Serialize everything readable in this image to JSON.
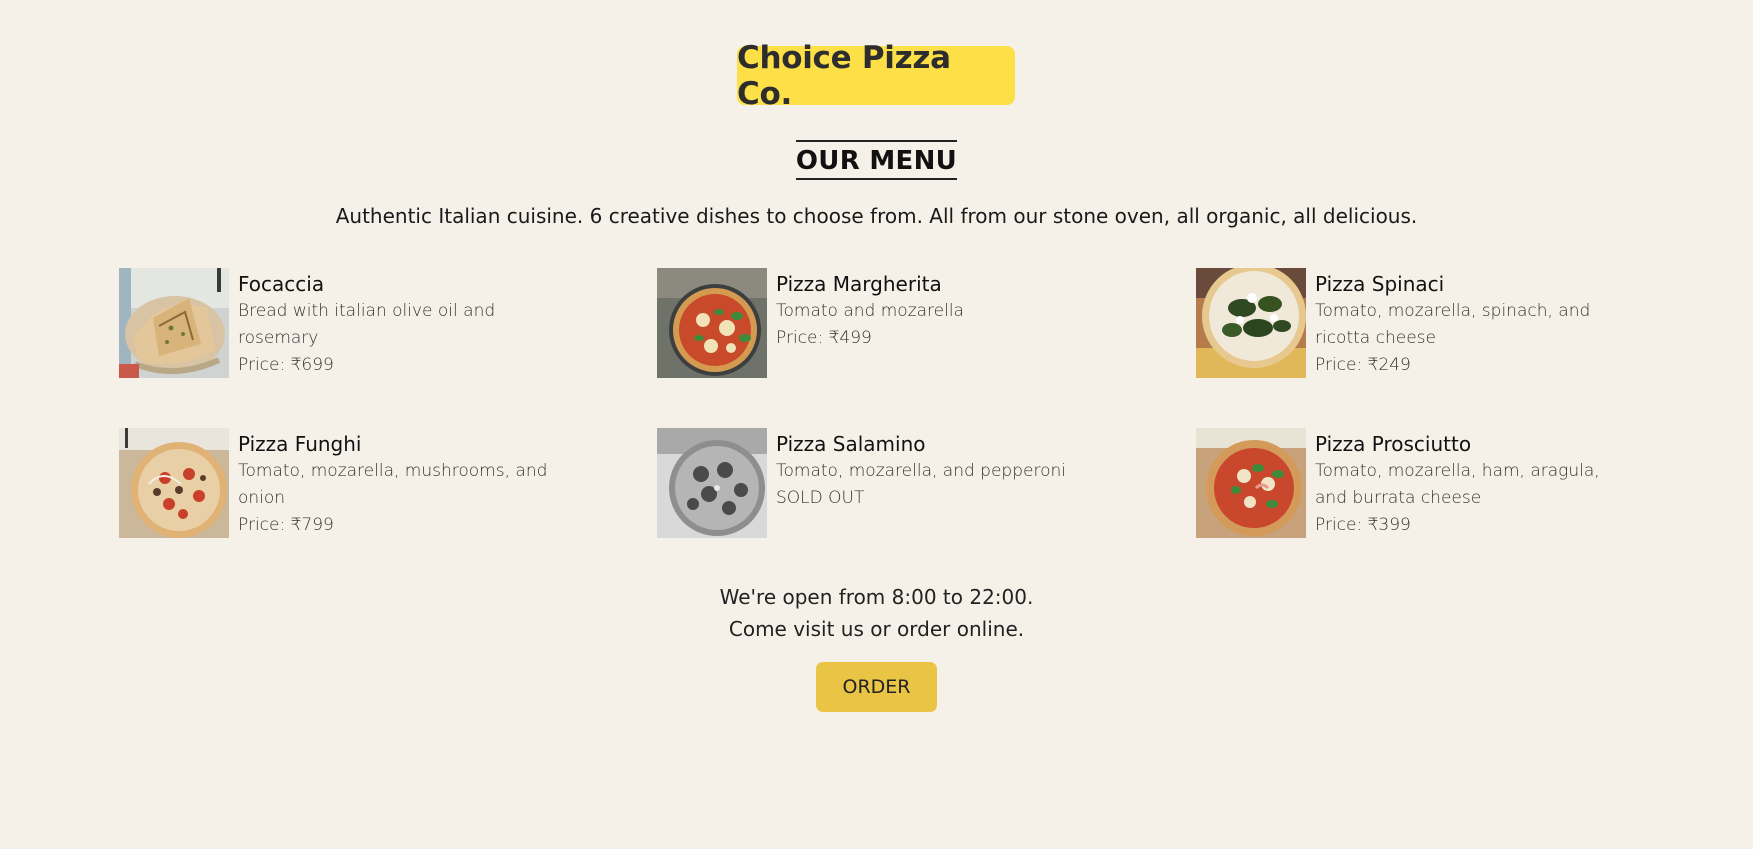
{
  "brand": {
    "name": "Choice Pizza Co.",
    "bg_color": "#fde047"
  },
  "menu": {
    "title": "OUR MENU",
    "tagline": "Authentic Italian cuisine. 6 creative dishes to choose from. All from our stone oven, all organic, all delicious."
  },
  "dishes": [
    {
      "name": "Focaccia",
      "description": "Bread with italian olive oil and rosemary",
      "price": "Price: ₹699",
      "image": "focaccia-photo"
    },
    {
      "name": "Pizza Margherita",
      "description": "Tomato and mozarella",
      "price": "Price: ₹499",
      "image": "pizza-margherita-photo"
    },
    {
      "name": "Pizza Spinaci",
      "description": "Tomato, mozarella, spinach, and ricotta cheese",
      "price": "Price: ₹249",
      "image": "pizza-spinaci-photo"
    },
    {
      "name": "Pizza Funghi",
      "description": "Tomato, mozarella, mushrooms, and onion",
      "price": "Price: ₹799",
      "image": "pizza-funghi-photo"
    },
    {
      "name": "Pizza Salamino",
      "description": "Tomato, mozarella, and pepperoni",
      "price": "SOLD OUT",
      "image": "pizza-salamino-photo",
      "sold_out": true
    },
    {
      "name": "Pizza Prosciutto",
      "description": "Tomato, mozarella, ham, aragula, and burrata cheese",
      "price": "Price: ₹399",
      "image": "pizza-prosciutto-photo"
    }
  ],
  "footer": {
    "hours": "We're open from 8:00 to 22:00.",
    "cta_text": "Come visit us or order online.",
    "order_label": "ORDER",
    "order_color": "#eac444"
  },
  "colors": {
    "background": "#f6f1e8"
  }
}
